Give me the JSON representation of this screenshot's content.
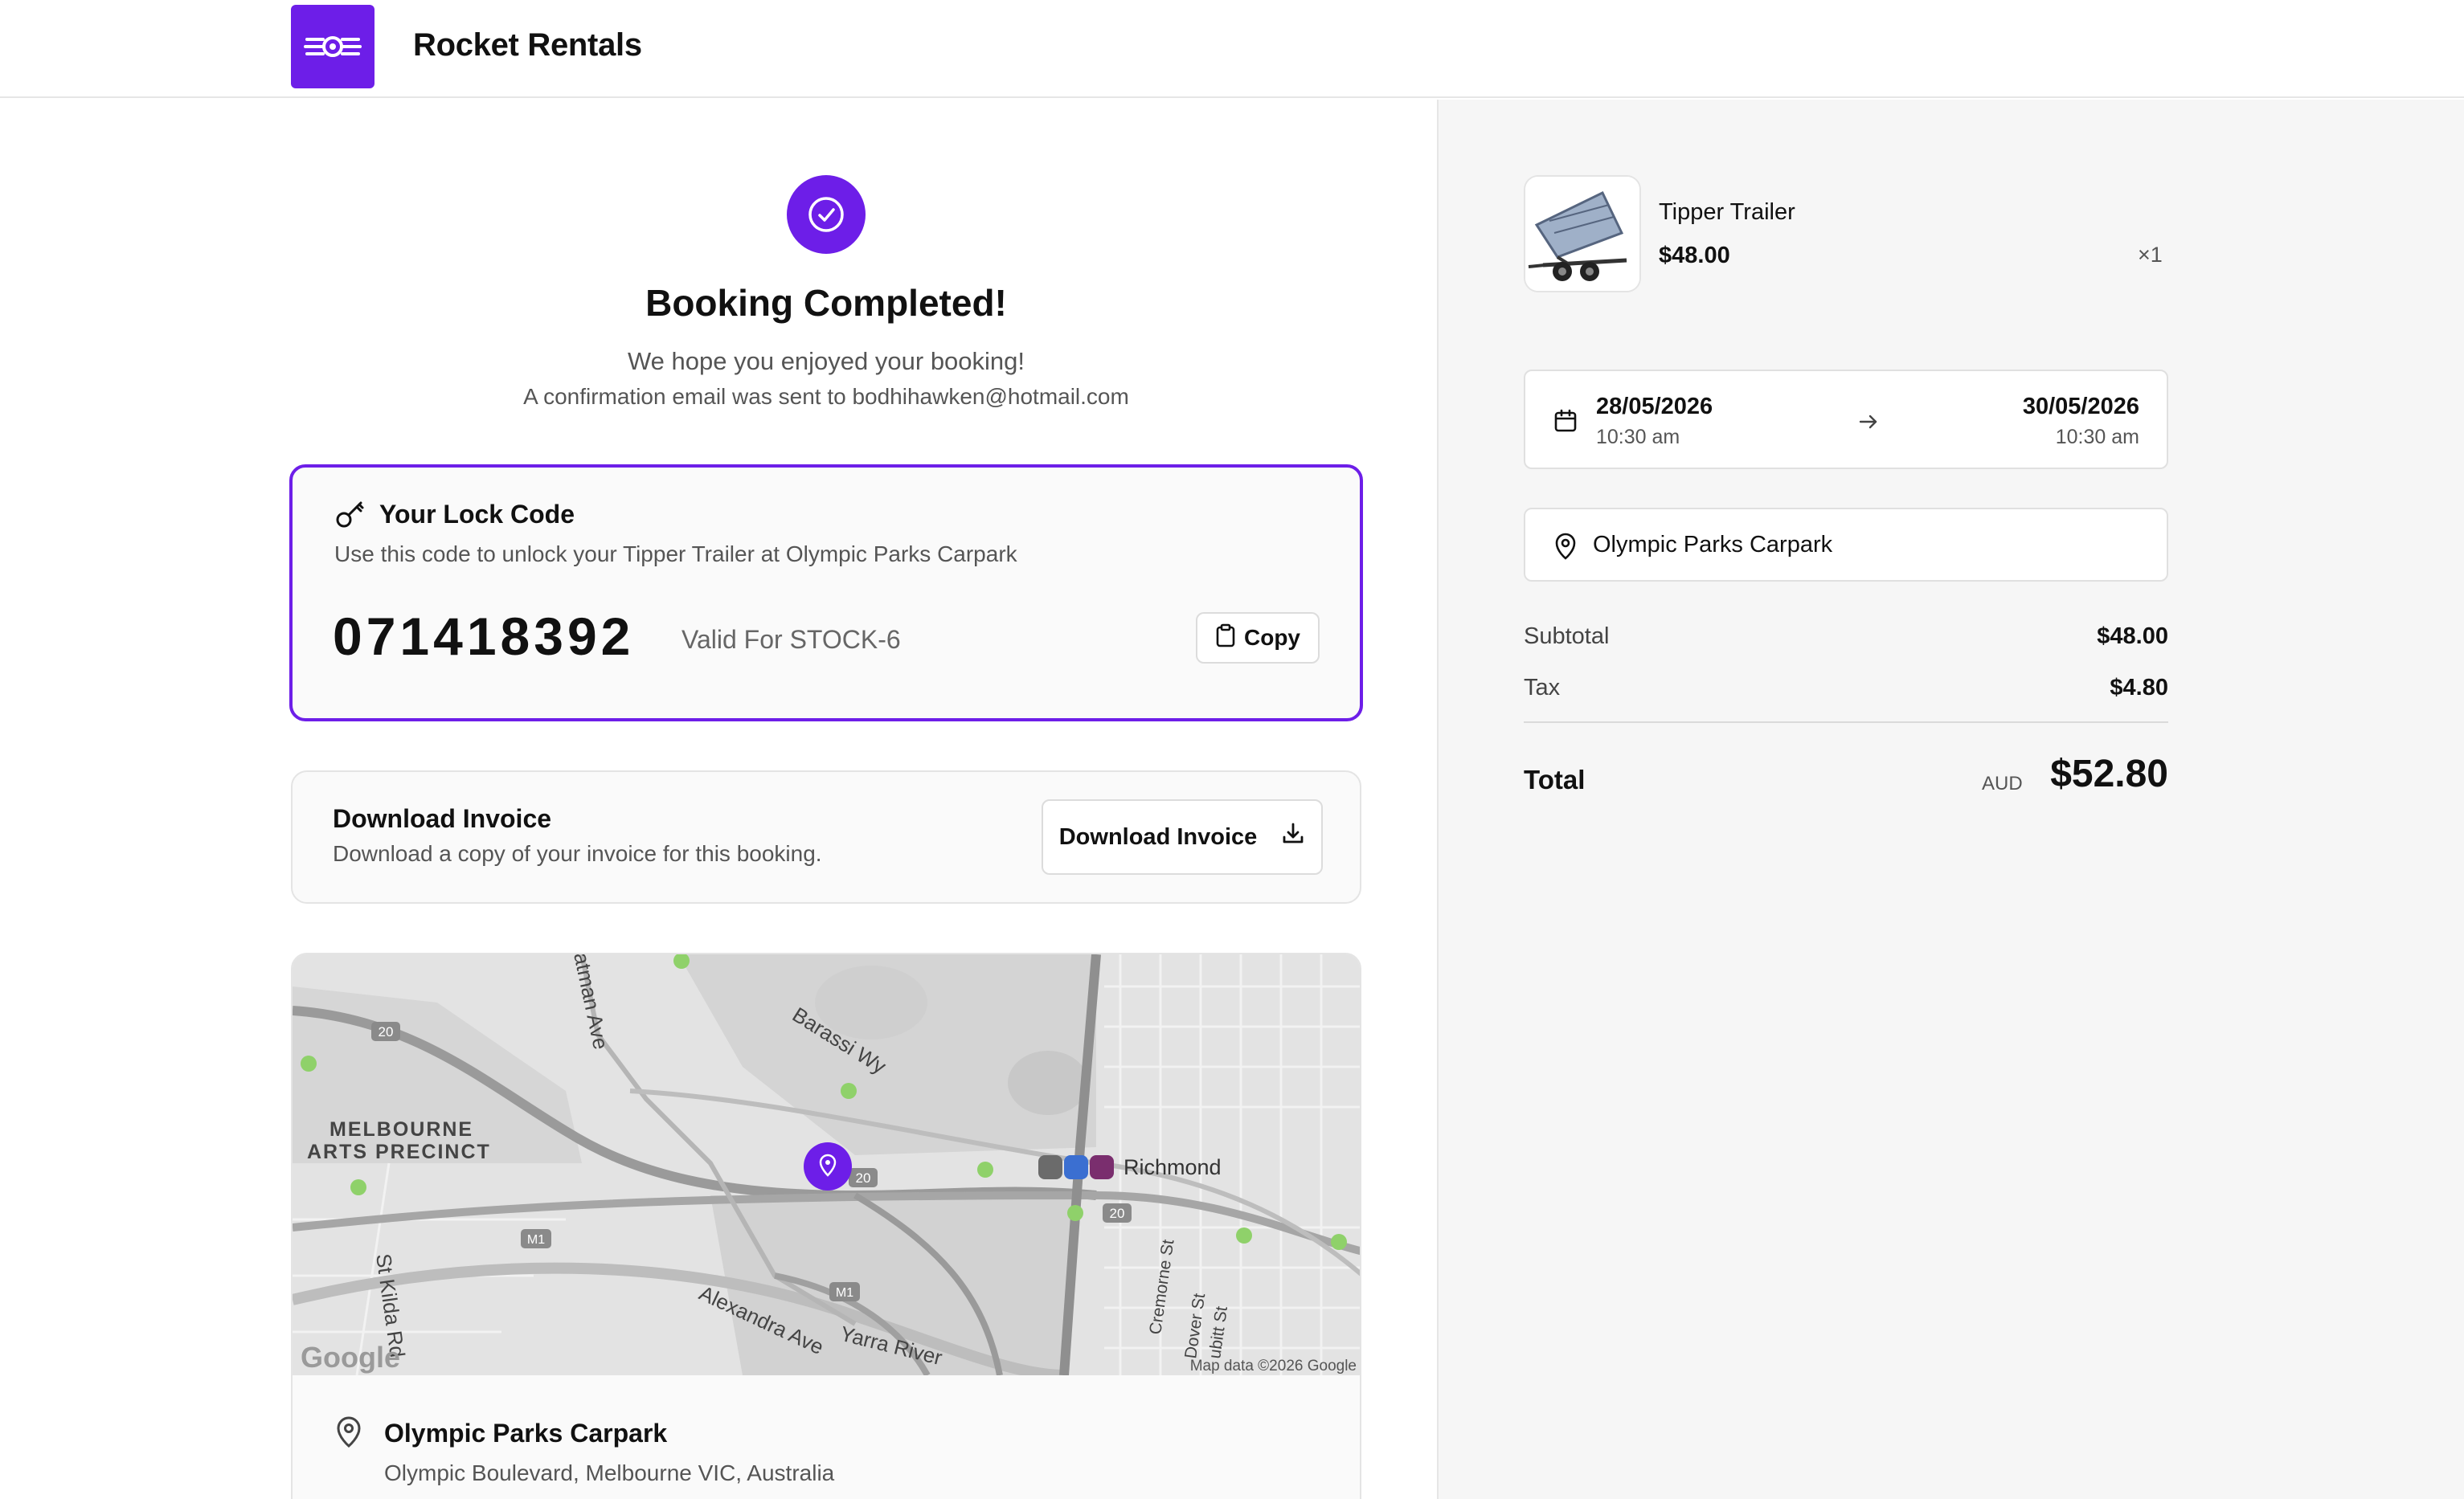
{
  "header": {
    "brand": "Rocket Rentals",
    "logo_color": "#6d1ee8"
  },
  "confirmation": {
    "title": "Booking Completed!",
    "subtitle": "We hope you enjoyed your booking!",
    "email_line": "A confirmation email was sent to bodhihawken@hotmail.com"
  },
  "lock": {
    "title": "Your Lock Code",
    "description": "Use this code to unlock your Tipper Trailer at Olympic Parks Carpark",
    "code": "071418392",
    "valid_for": "Valid For STOCK-6",
    "copy_label": "Copy"
  },
  "invoice": {
    "title": "Download Invoice",
    "description": "Download a copy of your invoice for this booking.",
    "button_label": "Download Invoice"
  },
  "map": {
    "labels": {
      "precinct_line1": "MELBOURNE",
      "precinct_line2": "ARTS PRECINCT",
      "barassi": "Barassi Wy",
      "batman": "atman Ave",
      "richmond": "Richmond",
      "st_kilda": "St Kilda Rd",
      "alexandra": "Alexandra Ave",
      "yarra": "Yarra River",
      "cremorne": "Cremorne St",
      "dover": "Dover St",
      "gibbit": "ubitt St",
      "route_20": "20",
      "route_m1": "M1",
      "google": "Google",
      "attribution": "Map data ©2026 Google"
    },
    "location_name": "Olympic Parks Carpark",
    "location_address": "Olympic Boulevard, Melbourne VIC, Australia"
  },
  "order": {
    "item_name": "Tipper Trailer",
    "item_price": "$48.00",
    "item_qty": "×1",
    "start_date": "28/05/2026",
    "start_time": "10:30 am",
    "end_date": "30/05/2026",
    "end_time": "10:30 am",
    "location": "Olympic Parks Carpark",
    "subtotal_label": "Subtotal",
    "subtotal_value": "$48.00",
    "tax_label": "Tax",
    "tax_value": "$4.80",
    "total_label": "Total",
    "total_currency": "AUD",
    "total_value": "$52.80"
  },
  "icons": [
    "rocket-logo-icon",
    "check-circle-icon",
    "key-icon",
    "clipboard-icon",
    "download-icon",
    "map-pin-icon",
    "calendar-icon",
    "arrow-right-icon"
  ]
}
